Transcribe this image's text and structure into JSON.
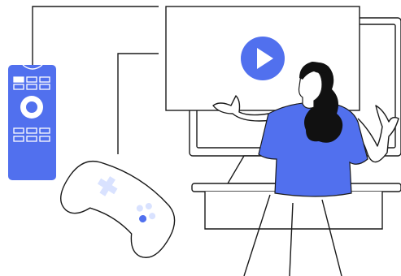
{
  "colors": {
    "accent": "#5170EE",
    "accent_light": "#D9E2FF",
    "stroke": "#1A1A1A",
    "hair": "#111111",
    "background": "#FFFFFF"
  },
  "icons": {
    "remote": "remote-control-icon",
    "monitor": "monitor-icon",
    "play": "play-icon",
    "gamepad": "gamepad-icon",
    "person": "person-illustration"
  }
}
